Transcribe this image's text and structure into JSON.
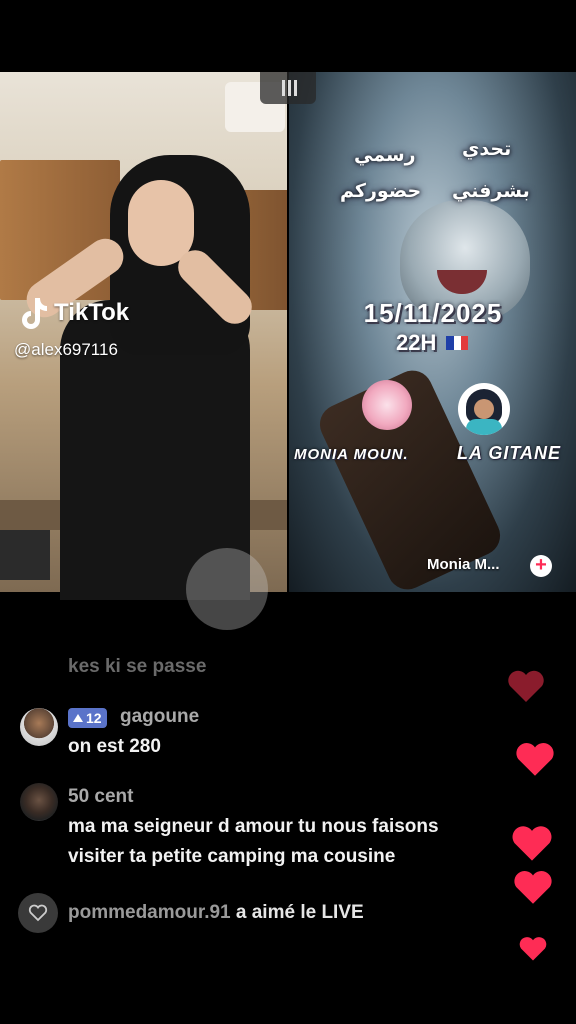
{
  "overlay": {
    "brand": "TikTok",
    "handle": "@alex697116"
  },
  "poster": {
    "arabic_line_1_right": "تحدي",
    "arabic_line_1_left": "رسمي",
    "arabic_line_2_right": "بشرفني",
    "arabic_line_2_left": "حضوركم",
    "date": "15/11/2025",
    "time": "22H",
    "flag_colors": [
      "#1f3fa8",
      "#ffffff",
      "#e23b3b"
    ],
    "name_left": "MONIA MOUN.",
    "name_right": "LA GITANE",
    "host_label": "Monia M...",
    "follow_symbol": "+"
  },
  "comments": {
    "faded_text": "kes ki se passe",
    "items": [
      {
        "badge_level": "12",
        "username": "gagoune",
        "text": "on est 280"
      },
      {
        "username": "50 cent",
        "text_line_1": "ma ma seigneur d amour tu nous faisons",
        "text_line_2": "visiter ta petite camping ma cousine"
      }
    ],
    "like_event": {
      "username": "pommedamour.91",
      "text": "a aimé le LIVE"
    }
  },
  "colors": {
    "heart": "#fe2c55",
    "badge": "#5a73c9"
  }
}
